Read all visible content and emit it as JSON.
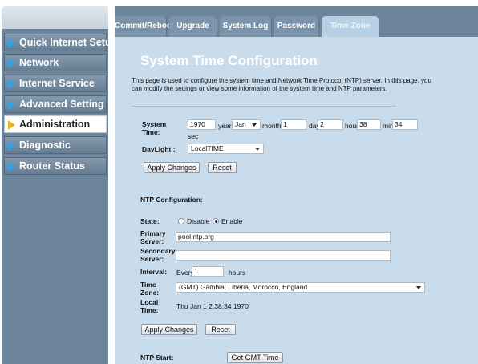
{
  "sidebar": {
    "items": [
      {
        "label": "Quick Internet Setup",
        "active": false
      },
      {
        "label": "Network",
        "active": false
      },
      {
        "label": "Internet Service",
        "active": false
      },
      {
        "label": "Advanced Setting",
        "active": false
      },
      {
        "label": "Administration",
        "active": true
      },
      {
        "label": "Diagnostic",
        "active": false
      },
      {
        "label": "Router Status",
        "active": false
      }
    ]
  },
  "tabs": [
    {
      "label": "Commit/Reboot"
    },
    {
      "label": "Upgrade"
    },
    {
      "label": "System Log"
    },
    {
      "label": "Password"
    },
    {
      "label": "Time Zone"
    }
  ],
  "active_tab": "Time Zone",
  "page": {
    "title": "System Time Configuration",
    "intro": "This page is used to configure the system time and Network Time Protocol (NTP) server. In this page, you can modify the settings or view some information of the system time and NTP parameters."
  },
  "system_time": {
    "label": "System Time:",
    "year_value": "1970",
    "year_unit": "year",
    "month_value": "Jan",
    "month_unit": "month",
    "day_value": "1",
    "day_unit": "day",
    "hour_value": "2",
    "hour_unit": "hour",
    "min_value": "38",
    "min_unit": "min",
    "sec_value": "34",
    "sec_unit": "sec"
  },
  "daylight": {
    "label": "DayLight :",
    "value": "LocalTIME"
  },
  "buttons": {
    "apply": "Apply Changes",
    "reset": "Reset",
    "get_gmt": "Get GMT Time"
  },
  "ntp": {
    "heading": "NTP Configuration:",
    "state_label": "State:",
    "state_options": [
      "Disable",
      "Enable"
    ],
    "state_selected": "Enable",
    "primary_label": "Primary Server:",
    "primary_value": "pool.ntp.org",
    "secondary_label": "Secondary Server:",
    "secondary_value": "",
    "interval_label": "Interval:",
    "interval_prefix": "Every",
    "interval_value": "1",
    "interval_unit": "hours",
    "timezone_label": "Time Zone:",
    "timezone_value": "(GMT) Gambia, Liberia, Morocco, England",
    "localtime_label": "Local Time:",
    "localtime_value": "Thu Jan 1 2:38:34 1970",
    "start_label": "NTP Start:"
  },
  "colors": {
    "panel": "#c8dcec",
    "frame": "#6d859b",
    "active_arrow": "#e8b41c",
    "arrow": "#2fa5e8"
  }
}
